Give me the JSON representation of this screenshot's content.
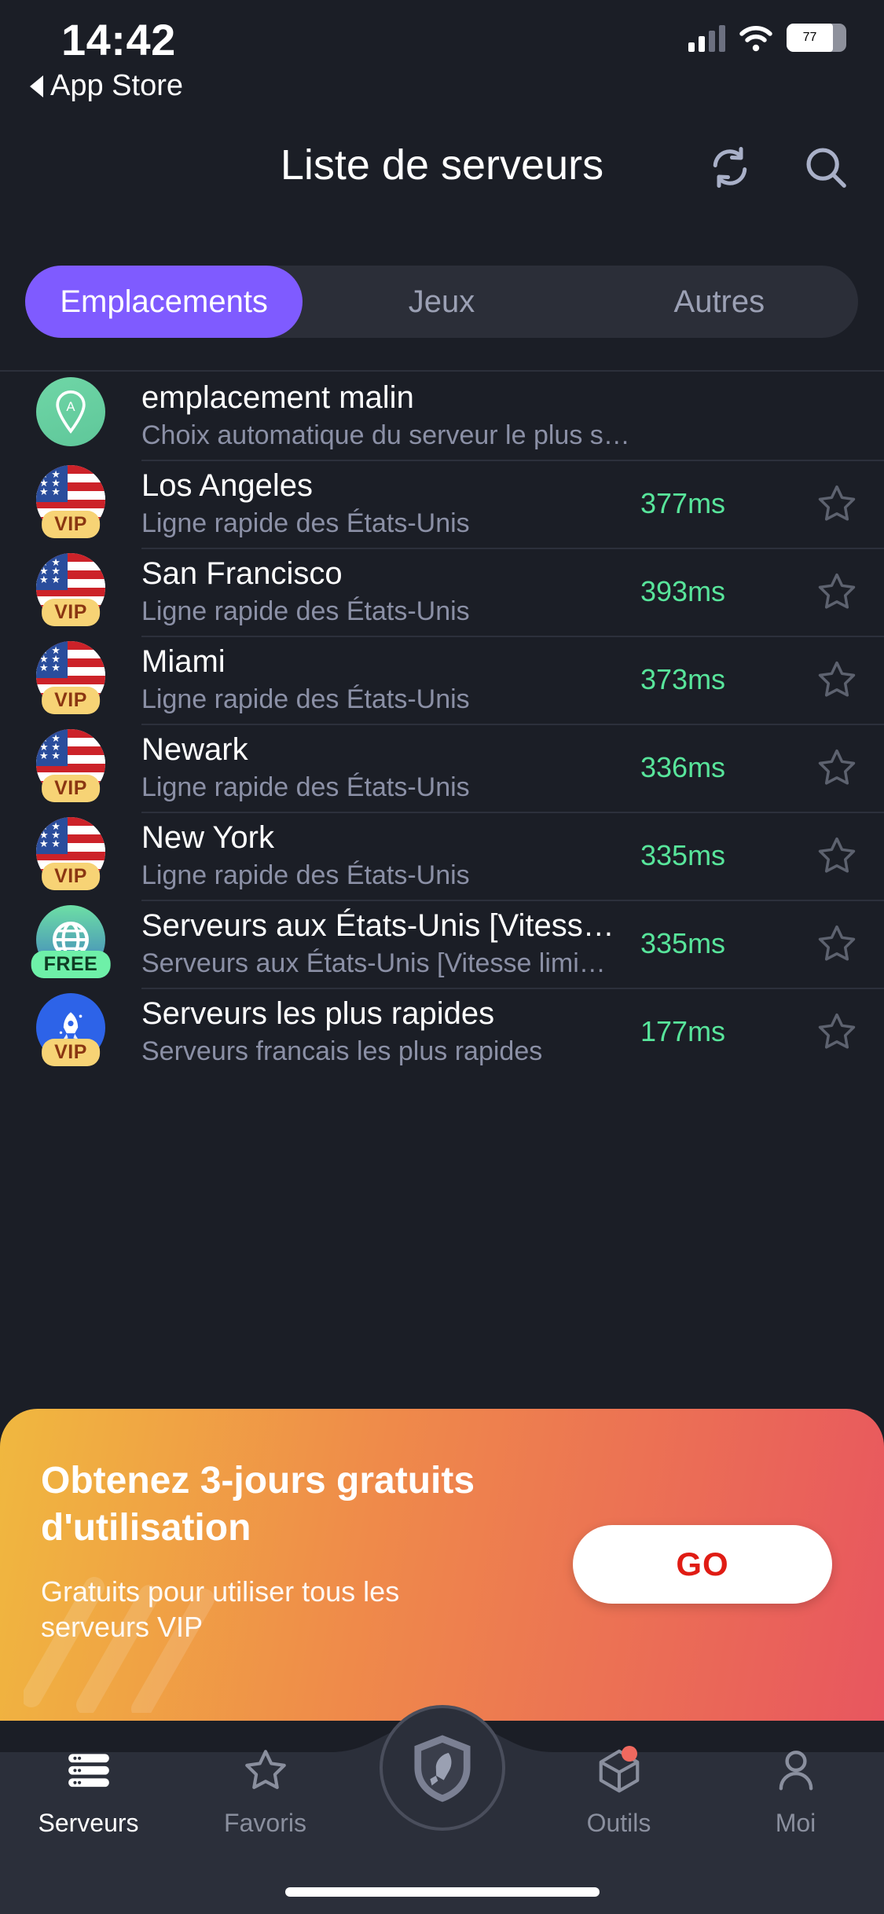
{
  "statusbar": {
    "time": "14:42",
    "back_label": "App Store",
    "battery": "77"
  },
  "header": {
    "title": "Liste de serveurs",
    "refresh_icon": "refresh-icon",
    "search_icon": "search-icon"
  },
  "tabs": [
    {
      "label": "Emplacements",
      "active": true
    },
    {
      "label": "Jeux",
      "active": false
    },
    {
      "label": "Autres",
      "active": false
    }
  ],
  "servers": [
    {
      "icon": "smart-location-pin-icon",
      "badge": "",
      "title": "emplacement malin",
      "subtitle": "Choix automatique du serveur le plus stable",
      "ping": "",
      "star": ""
    },
    {
      "icon": "us-flag-icon",
      "badge": "VIP",
      "title": "Los Angeles",
      "subtitle": "Ligne rapide des États-Unis",
      "ping": "377ms",
      "star": "star-outline-icon"
    },
    {
      "icon": "us-flag-icon",
      "badge": "VIP",
      "title": "San Francisco",
      "subtitle": "Ligne rapide des États-Unis",
      "ping": "393ms",
      "star": "star-outline-icon"
    },
    {
      "icon": "us-flag-icon",
      "badge": "VIP",
      "title": "Miami",
      "subtitle": "Ligne rapide des États-Unis",
      "ping": "373ms",
      "star": "star-outline-icon"
    },
    {
      "icon": "us-flag-icon",
      "badge": "VIP",
      "title": "Newark",
      "subtitle": "Ligne rapide des États-Unis",
      "ping": "336ms",
      "star": "star-outline-icon"
    },
    {
      "icon": "us-flag-icon",
      "badge": "VIP",
      "title": "New York",
      "subtitle": "Ligne rapide des États-Unis",
      "ping": "335ms",
      "star": "star-outline-icon"
    },
    {
      "icon": "globe-icon",
      "badge": "FREE",
      "title": "Serveurs aux États-Unis [Vitess…",
      "subtitle": "Serveurs aux États-Unis [Vitesse limi…",
      "ping": "335ms",
      "star": "star-outline-icon"
    },
    {
      "icon": "rocket-icon",
      "badge": "VIP",
      "title": "Serveurs les plus rapides",
      "subtitle": "Serveurs francais les plus rapides",
      "ping": "177ms",
      "star": "star-outline-icon"
    }
  ],
  "promo": {
    "title": "Obtenez 3-jours gratuits d'utilisation",
    "subtitle": "Gratuits pour utiliser tous les serveurs VIP",
    "cta": "GO"
  },
  "nav": [
    {
      "label": "Serveurs",
      "icon": "servers-stack-icon",
      "active": true,
      "dot": false
    },
    {
      "label": "Favoris",
      "icon": "star-outline-icon",
      "active": false,
      "dot": false
    },
    {
      "label": "Outils",
      "icon": "toolbox-cube-icon",
      "active": false,
      "dot": true
    },
    {
      "label": "Moi",
      "icon": "person-icon",
      "active": false,
      "dot": false
    }
  ],
  "nav_center": {
    "icon": "shield-rocket-icon"
  },
  "colors": {
    "background": "#1b1e26",
    "accent_purple": "#7f5bff",
    "ping_green": "#58e59b",
    "badge_vip": "#f7d375",
    "badge_free": "#6ef0a8",
    "promo_start": "#f0b83f",
    "promo_end": "#e8565f",
    "cta_text": "#e01c14"
  }
}
